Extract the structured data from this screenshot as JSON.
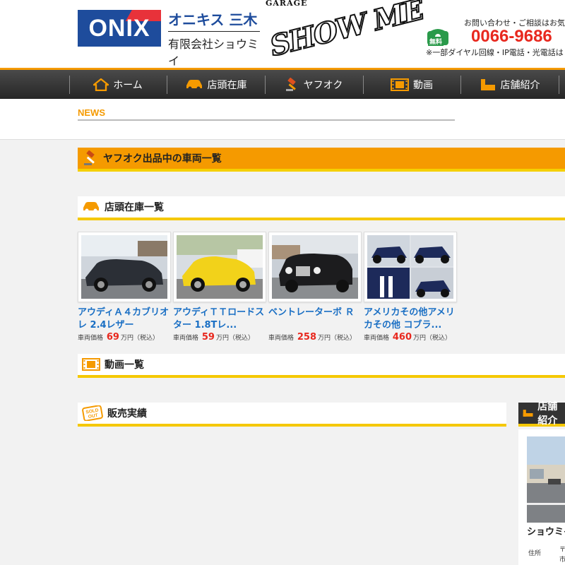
{
  "header": {
    "logo_onix": "ONIX",
    "logo_jp_brand": "オニキス 三木",
    "logo_jp_company": "有限会社ショウミイ",
    "logo_garage": "GARAGE",
    "logo_showme": "SHOW ME",
    "contact_text": "お問い合わせ・ご相談はお気軽に",
    "phone_free_badge": "無料",
    "phone_number": "0066-9686",
    "phone_note": "※一部ダイヤル回線・IP電話・光電話は"
  },
  "nav": {
    "items": [
      {
        "label": "ホーム",
        "icon": "house-icon"
      },
      {
        "label": "店頭在庫",
        "icon": "car-icon"
      },
      {
        "label": "ヤフオク",
        "icon": "gavel-icon"
      },
      {
        "label": "動画",
        "icon": "film-icon"
      },
      {
        "label": "店舗紹介",
        "icon": "shop-icon"
      }
    ]
  },
  "news": {
    "title": "NEWS"
  },
  "sections": {
    "yafuoku": "ヤフオク出品中の車両一覧",
    "tenpo": "店頭在庫一覧",
    "douga": "動画一覧",
    "hanbai": "販売実績",
    "store": "店舗紹介"
  },
  "sold_out_badge": "SOLD OUT",
  "cars": [
    {
      "name": "アウディＡ４カブリオレ 2.4レザー",
      "price_label": "車両価格",
      "price": "69",
      "price_unit": "万円（税込）",
      "body_color": "#2b2f36"
    },
    {
      "name": "アウディＴＴロードスター 1.8Tレ...",
      "price_label": "車両価格",
      "price": "59",
      "price_unit": "万円（税込）",
      "body_color": "#f2d21a"
    },
    {
      "name": "ベントレーターボ Ｒ",
      "price_label": "車両価格",
      "price": "258",
      "price_unit": "万円（税込）",
      "body_color": "#1c1c1e"
    },
    {
      "name": "アメリカその他アメリカその他 コブラ...",
      "price_label": "車両価格",
      "price": "460",
      "price_unit": "万円（税込）",
      "body_color": "#1d2a5a"
    }
  ],
  "store": {
    "name": "ショウミイ",
    "address_label": "住所",
    "address_value": "〒 市"
  },
  "colors": {
    "accent_orange": "#f59a00",
    "accent_yellow": "#f5c800",
    "link_blue": "#1a6fc4",
    "price_red": "#e8281e",
    "brand_blue": "#1e4c9c"
  }
}
